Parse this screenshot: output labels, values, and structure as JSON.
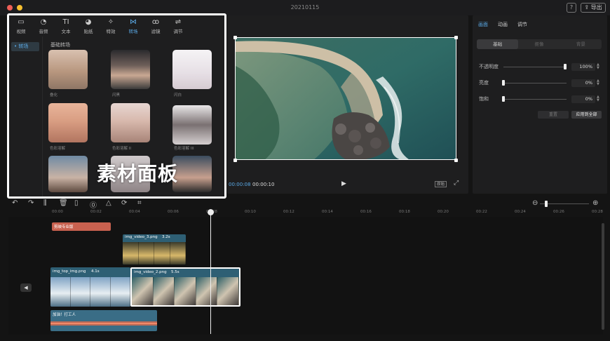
{
  "window": {
    "title": "20210115",
    "help_label": "?",
    "export_label": "导出"
  },
  "media_panel": {
    "tabs": [
      {
        "icon": "video-icon",
        "glyph": "▭",
        "label": "视频"
      },
      {
        "icon": "audio-icon",
        "glyph": "◔",
        "label": "音频"
      },
      {
        "icon": "text-icon",
        "glyph": "TI",
        "label": "文本"
      },
      {
        "icon": "sticker-icon",
        "glyph": "◕",
        "label": "贴纸"
      },
      {
        "icon": "effects-icon",
        "glyph": "✧",
        "label": "特效"
      },
      {
        "icon": "transition-icon",
        "glyph": "⋈",
        "label": "转场"
      },
      {
        "icon": "filter-icon",
        "glyph": "ꝏ",
        "label": "滤镜"
      },
      {
        "icon": "adjust-icon",
        "glyph": "⇌",
        "label": "调节"
      }
    ],
    "active_tab": 5,
    "sidebar_item": "• 转场",
    "section_title": "基础转场",
    "thumbnails": [
      {
        "label": "叠化"
      },
      {
        "label": "闪黑"
      },
      {
        "label": "闪白"
      },
      {
        "label": "色彩溶解"
      },
      {
        "label": "色彩溶解 II"
      },
      {
        "label": "色彩溶解 III"
      }
    ],
    "overlay_label": "素材面板"
  },
  "preview": {
    "current_time": "00:00:08",
    "total_time": "00:00:10",
    "play_glyph": "▶",
    "ratio_label": "原始",
    "fullscreen_glyph": "⤢"
  },
  "properties": {
    "tabs": [
      "画面",
      "动画",
      "调节"
    ],
    "active_tab": 0,
    "sub_tabs": [
      "基础",
      "抠像",
      "背景"
    ],
    "active_sub_tab": 0,
    "rows": [
      {
        "label": "不透明度",
        "value": "100%",
        "level": 1.0
      },
      {
        "label": "亮度",
        "value": "0%",
        "level": 0.0
      },
      {
        "label": "饱和",
        "value": "0%",
        "level": 0.0
      }
    ],
    "reset_label": "重置",
    "apply_all_label": "应用到全部"
  },
  "timeline": {
    "toolbar_glyphs": [
      "↶",
      "↷",
      "⫼",
      "🗑",
      "▯",
      "⓪",
      "△",
      "⟳",
      "⌗"
    ],
    "zoom_out_glyph": "⊖",
    "zoom_in_glyph": "⊕",
    "zoom_level": 0.1,
    "ruler": [
      "00:00",
      "00:02",
      "00:04",
      "00:06",
      "00:08",
      "00:10",
      "00:12",
      "00:14",
      "00:16",
      "00:18",
      "00:20",
      "00:22",
      "00:24",
      "00:26",
      "00:28"
    ],
    "clips": {
      "text_clip": {
        "label": "剪映专业版"
      },
      "overlay_clip": {
        "name": "img_video_3.png",
        "duration": "3.2s"
      },
      "main_clip_1": {
        "name": "img_top_img.png",
        "duration": "4.1s"
      },
      "main_clip_2": {
        "name": "img_video_2.png",
        "duration": "5.5s"
      },
      "audio_clip": {
        "label": "加油！打工人"
      }
    },
    "track_icon_glyph": "◀"
  },
  "colors": {
    "accent": "#5aa9e6",
    "text_clip": "#c8614f",
    "video_clip": "#2e5f74",
    "audio_clip": "#3a6d86"
  }
}
